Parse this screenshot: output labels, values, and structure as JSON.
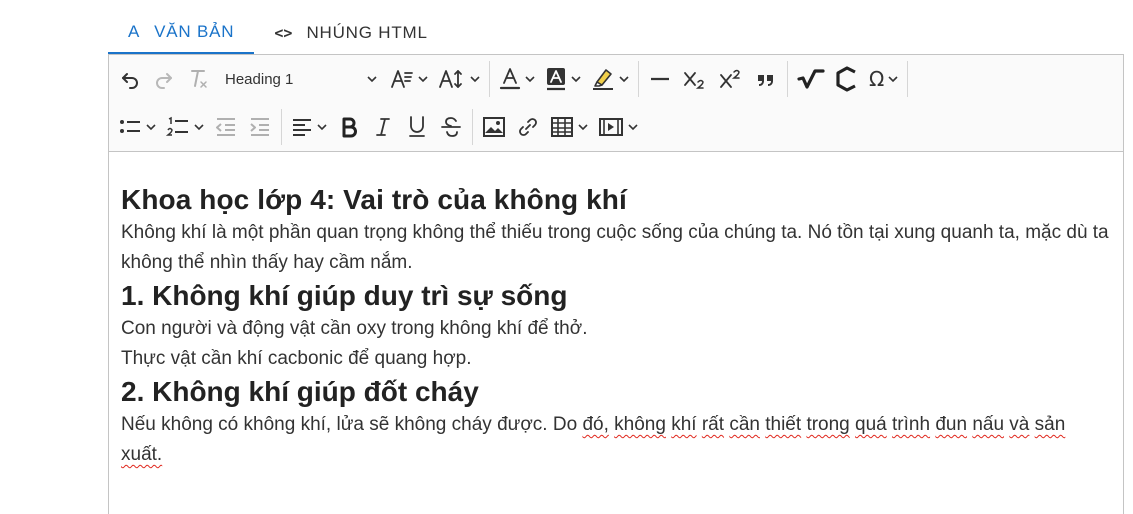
{
  "tabs": [
    {
      "icon": "A",
      "label": "VĂN BẢN",
      "active": true
    },
    {
      "icon": "<>",
      "label": "NHÚNG HTML",
      "active": false
    }
  ],
  "toolbar": {
    "heading_value": "Heading 1",
    "icons": [
      "undo-icon",
      "redo-icon",
      "remove-format-icon",
      "font-size-icon",
      "line-height-icon",
      "font-color-icon",
      "background-color-icon",
      "highlight-icon",
      "horizontal-line-icon",
      "subscript-icon",
      "superscript-icon",
      "blockquote-icon",
      "math-formula-icon",
      "chemistry-formula-icon",
      "special-characters-icon",
      "bulleted-list-icon",
      "numbered-list-icon",
      "outdent-icon",
      "indent-icon",
      "align-icon",
      "bold-icon",
      "italic-icon",
      "underline-icon",
      "strikethrough-icon",
      "image-icon",
      "link-icon",
      "table-icon",
      "media-embed-icon"
    ]
  },
  "content": {
    "title": "Khoa học lớp 4: Vai trò của không khí",
    "intro": "Không khí là một phần quan trọng không thể thiếu trong cuộc sống của chúng ta. Nó tồn tại xung quanh ta, mặc dù ta không thể nhìn thấy hay cầm nắm.",
    "section1": {
      "heading": "1. Không khí giúp duy trì sự sống",
      "lines": [
        "Con người và động vật cần oxy trong không khí để thở.",
        "Thực vật cần khí cacbonic để quang hợp."
      ]
    },
    "section2": {
      "heading": "2. Không khí giúp đốt cháy",
      "p_start": "Nếu không có không khí, lửa sẽ không cháy được. Do ",
      "p_words": [
        "đó,",
        "không",
        "khí",
        "rất",
        "cần",
        "thiết",
        "trong",
        "quá",
        "trình",
        "đun",
        "nấu",
        "và",
        "sản",
        "xuất."
      ]
    }
  },
  "colors": {
    "accent": "#1a73c9",
    "spellcheck": "#e0271d",
    "toolbar_bg": "#fafafa",
    "border": "#c4c4c4"
  }
}
